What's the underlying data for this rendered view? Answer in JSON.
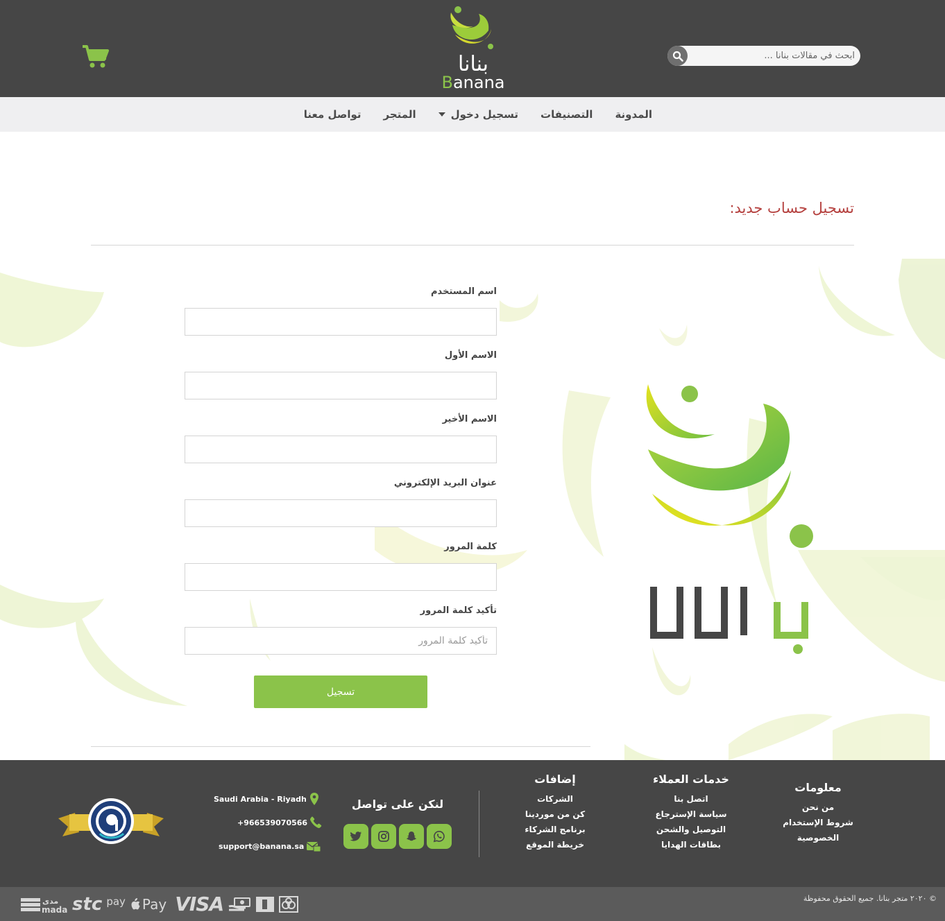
{
  "header": {
    "search_placeholder": "ابحث في مقالات بنانا ...",
    "logo_ar": "بنانا",
    "logo_en_first": "B",
    "logo_en_rest": "anana"
  },
  "nav": {
    "items": [
      {
        "label": "المدونة"
      },
      {
        "label": "التصنيفات"
      },
      {
        "label": "تسجيل دخول"
      },
      {
        "label": "المتجر"
      },
      {
        "label": "تواصل معنا"
      }
    ]
  },
  "main": {
    "title": "تسجيل حساب جديد:",
    "fields": [
      {
        "label": "اسم المستخدم",
        "value": "",
        "placeholder": ""
      },
      {
        "label": "الاسم الأول",
        "value": "",
        "placeholder": ""
      },
      {
        "label": "الاسم الأخير",
        "value": "",
        "placeholder": ""
      },
      {
        "label": "عنوان البريد الإلكتروني",
        "value": "",
        "placeholder": ""
      },
      {
        "label": "كلمة المرور",
        "value": "",
        "placeholder": ""
      },
      {
        "label": "تأكيد كلمة المرور",
        "value": "",
        "placeholder": "تأكيد كلمة المرور"
      }
    ],
    "submit_label": "تسجيل",
    "brand_logo_text": "بنانا"
  },
  "footer": {
    "info": {
      "heading": "معلومات",
      "links": [
        "من نحن",
        "شروط الإستخدام",
        "الخصوصية"
      ]
    },
    "customer_service": {
      "heading": "خدمات العملاء",
      "links": [
        "اتصل بنا",
        "سياسة الإسترجاع",
        "التوصيل والشحن",
        "بطاقات الهدايا"
      ]
    },
    "additions": {
      "heading": "إضافات",
      "links": [
        "الشركات",
        "كن من موردينا",
        "برنامج الشركاء",
        "خريطة الموقع"
      ]
    },
    "social": {
      "heading": "لنكن على تواصل",
      "icons": [
        "whatsapp-icon",
        "snapchat-icon",
        "instagram-icon",
        "twitter-icon"
      ]
    },
    "contact": {
      "location": "Saudi Arabia - Riyadh",
      "phone": "+966539070566",
      "email": "support@banana.sa"
    },
    "copyright": "© ٢٠٢٠ متجر بنانا. جميع الحقوق محفوظة",
    "payments": {
      "mada_ar": "مدى",
      "mada_en": "mada",
      "stc": "stc",
      "stc_pay": "pay",
      "apple_pay": "Pay",
      "visa": "VISA"
    }
  },
  "colors": {
    "accent": "#8bc34a",
    "header_bg": "#464646",
    "nav_bg": "#efeff1",
    "title": "#b5413f",
    "bottom_bar": "#5b5b5b"
  }
}
